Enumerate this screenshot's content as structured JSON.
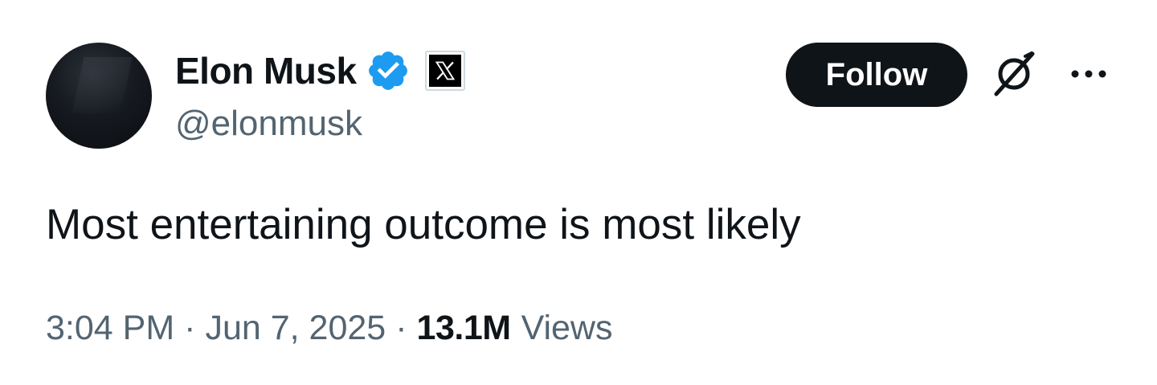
{
  "author": {
    "display_name": "Elon Musk",
    "handle": "@elonmusk",
    "verified_color": "#1d9bf0",
    "affiliate_badge_icon": "x-logo-icon"
  },
  "actions": {
    "follow_label": "Follow",
    "grok_icon": "grok-icon",
    "more_icon": "more-icon"
  },
  "tweet": {
    "text": "Most entertaining outcome is most likely",
    "time": "3:04 PM",
    "separator": "·",
    "date": "Jun 7, 2025",
    "views_count": "13.1M",
    "views_label": "Views"
  },
  "colors": {
    "text_primary": "#0f1419",
    "text_secondary": "#536471",
    "button_background": "#0f1419",
    "button_text": "#ffffff"
  }
}
